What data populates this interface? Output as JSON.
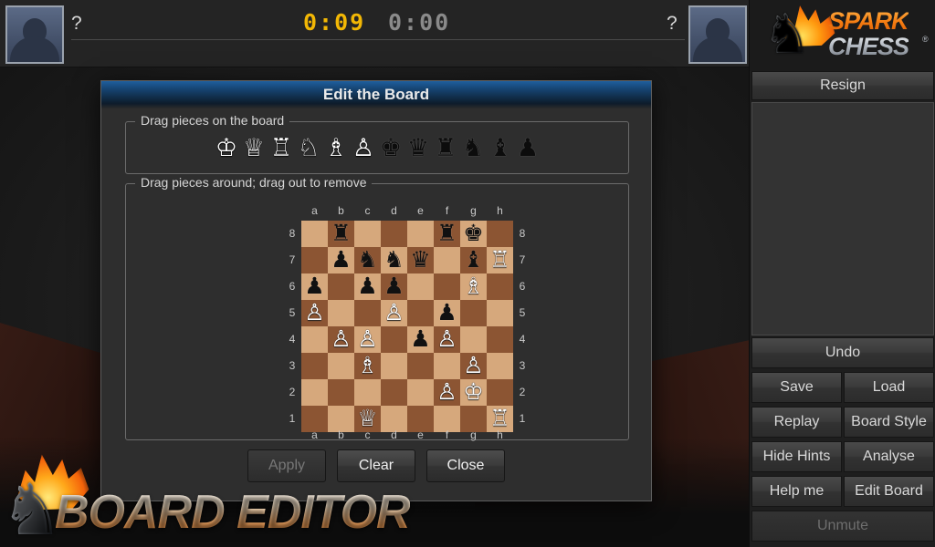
{
  "header": {
    "player_left_name": "?",
    "player_right_name": "?",
    "clock_left": "0:09",
    "clock_right": "0:00",
    "clock_active_color": "#f2b705",
    "clock_idle_color": "#8a8a8a"
  },
  "logo": {
    "word1": "SPARK",
    "word2": "CHESS",
    "registered": "®",
    "knight_glyph": "♞",
    "orange": "#f47a10",
    "silver": "#b4bac2"
  },
  "sidebar": {
    "resign": "Resign",
    "undo": "Undo",
    "save": "Save",
    "load": "Load",
    "replay": "Replay",
    "board_style": "Board Style",
    "hide_hints": "Hide Hints",
    "analyse": "Analyse",
    "help_me": "Help me",
    "edit_board": "Edit Board",
    "unmute": "Unmute"
  },
  "dialog": {
    "title": "Edit the Board",
    "legend_palette": "Drag pieces on the board",
    "legend_board": "Drag pieces around; drag out to remove",
    "apply": "Apply",
    "apply_enabled": false,
    "clear": "Clear",
    "close": "Close",
    "palette": [
      {
        "glyph": "♔",
        "color": "w",
        "name": "white-king"
      },
      {
        "glyph": "♕",
        "color": "w",
        "name": "white-queen"
      },
      {
        "glyph": "♖",
        "color": "w",
        "name": "white-rook"
      },
      {
        "glyph": "♘",
        "color": "w",
        "name": "white-knight"
      },
      {
        "glyph": "♗",
        "color": "w",
        "name": "white-bishop"
      },
      {
        "glyph": "♙",
        "color": "w",
        "name": "white-pawn"
      },
      {
        "glyph": "♚",
        "color": "b",
        "name": "black-king"
      },
      {
        "glyph": "♛",
        "color": "b",
        "name": "black-queen"
      },
      {
        "glyph": "♜",
        "color": "b",
        "name": "black-rook"
      },
      {
        "glyph": "♞",
        "color": "b",
        "name": "black-knight"
      },
      {
        "glyph": "♝",
        "color": "b",
        "name": "black-bishop"
      },
      {
        "glyph": "♟",
        "color": "b",
        "name": "black-pawn"
      }
    ]
  },
  "board": {
    "files": [
      "a",
      "b",
      "c",
      "d",
      "e",
      "f",
      "g",
      "h"
    ],
    "ranks": [
      "8",
      "7",
      "6",
      "5",
      "4",
      "3",
      "2",
      "1"
    ],
    "light_color": "#d6a87c",
    "dark_color": "#8c5533",
    "position": [
      [
        "",
        "r",
        "",
        "",
        "",
        "r",
        "k",
        ""
      ],
      [
        "",
        "p",
        "n",
        "n",
        "q",
        "",
        "b",
        "R"
      ],
      [
        "p",
        "",
        "p",
        "p",
        "",
        "",
        "B",
        ""
      ],
      [
        "P",
        "",
        "",
        "P",
        "",
        "p",
        "",
        ""
      ],
      [
        "",
        "P",
        "P",
        "",
        "p",
        "P",
        "",
        ""
      ],
      [
        "",
        "",
        "B",
        "",
        "",
        "",
        "P",
        ""
      ],
      [
        "",
        "",
        "",
        "",
        "",
        "P",
        "K",
        ""
      ],
      [
        "",
        "",
        "Q",
        "",
        "",
        "",
        "",
        "R"
      ]
    ]
  },
  "banner": {
    "text": "BOARD EDITOR",
    "knight_glyph": "♞"
  }
}
